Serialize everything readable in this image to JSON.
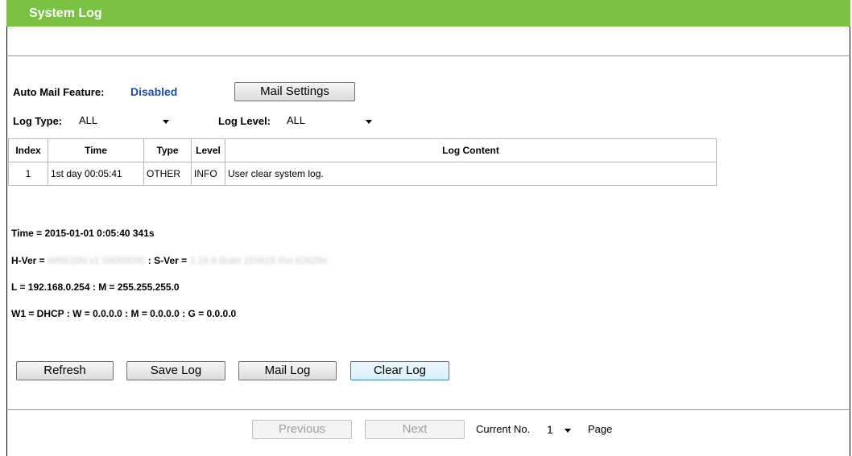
{
  "header": {
    "title": "System Log"
  },
  "mail": {
    "label": "Auto Mail Feature:",
    "status": "Disabled",
    "settings_button": "Mail Settings"
  },
  "filters": {
    "log_type_label": "Log Type:",
    "log_type_value": "ALL",
    "log_level_label": "Log Level:",
    "log_level_value": "ALL"
  },
  "table": {
    "headers": [
      "Index",
      "Time",
      "Type",
      "Level",
      "Log Content"
    ],
    "rows": [
      [
        "1",
        "1st day 00:05:41",
        "OTHER",
        "INFO",
        "User clear system log."
      ]
    ]
  },
  "system_info": {
    "time_line": "Time = 2015-01-01 0:05:40 341s",
    "hver_label": "H-Ver = ",
    "hver_value": "WR810N v1 00000000",
    "sver_label": " : S-Ver = ",
    "sver_value": "3.16.9 Build 150615 Rel.62629n",
    "lan_line": "L = 192.168.0.254 : M = 255.255.255.0",
    "wan_line": "W1 = DHCP : W = 0.0.0.0 : M = 0.0.0.0 : G = 0.0.0.0"
  },
  "actions": {
    "refresh": "Refresh",
    "save_log": "Save Log",
    "mail_log": "Mail Log",
    "clear_log": "Clear Log"
  },
  "pagination": {
    "previous": "Previous",
    "next": "Next",
    "current_label": "Current No.",
    "current_value": "1",
    "page_label": "Page"
  },
  "colors": {
    "header_green": "#7ac143",
    "status_blue": "#1f4e9b"
  }
}
